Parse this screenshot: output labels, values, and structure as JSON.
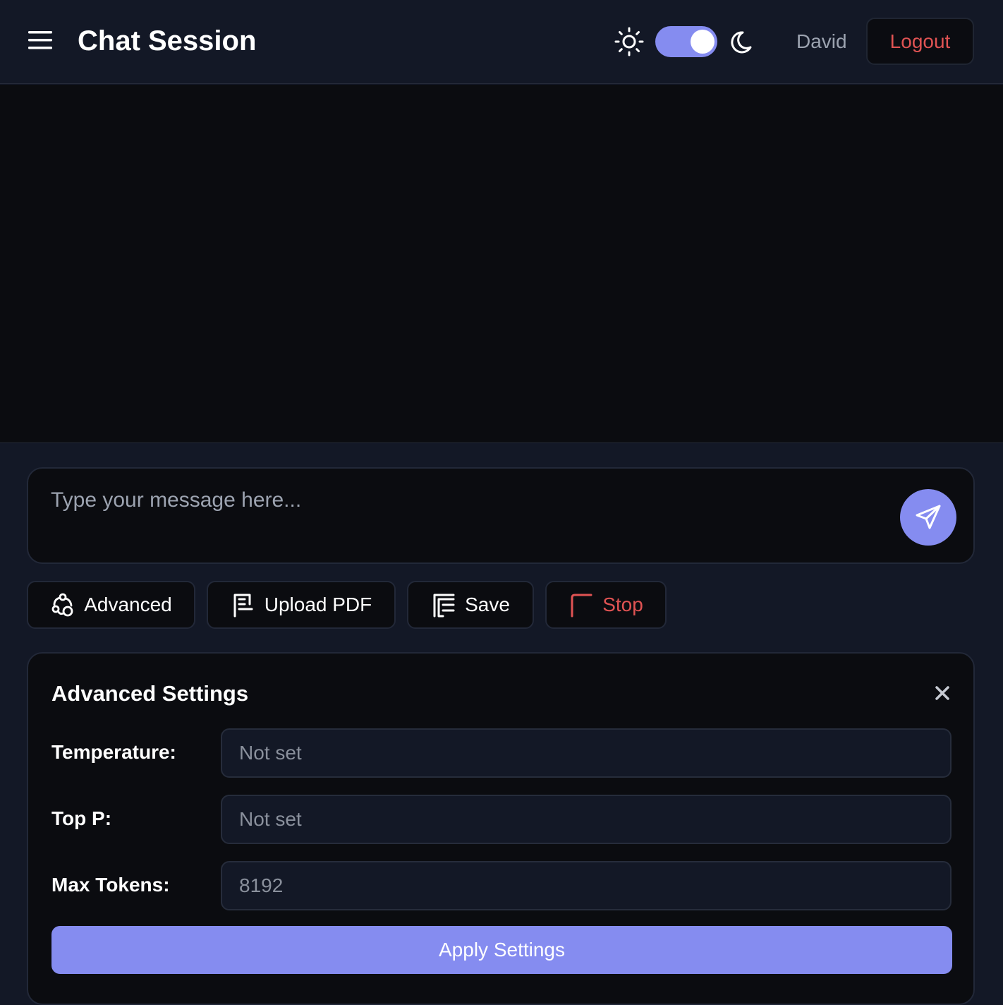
{
  "header": {
    "menu_icon": "hamburger-menu-icon",
    "title": "Chat Session",
    "theme": {
      "light_icon": "sun-icon",
      "dark_icon": "moon-icon",
      "dark_mode": true,
      "accent": "#858cf0"
    },
    "user_name": "David",
    "logout_label": "Logout",
    "logout_color": "#e05353"
  },
  "composer": {
    "placeholder": "Type your message here...",
    "value": "",
    "send_icon": "send-icon"
  },
  "actions": {
    "advanced_label": "Advanced",
    "upload_label": "Upload PDF",
    "save_label": "Save",
    "stop_label": "Stop"
  },
  "settings": {
    "title": "Advanced Settings",
    "close_icon": "close-icon",
    "temperature_label": "Temperature:",
    "temperature_placeholder": "Not set",
    "top_p_label": "Top P:",
    "top_p_placeholder": "Not set",
    "max_tokens_label": "Max Tokens:",
    "max_tokens_placeholder": "8192",
    "apply_label": "Apply Settings"
  }
}
